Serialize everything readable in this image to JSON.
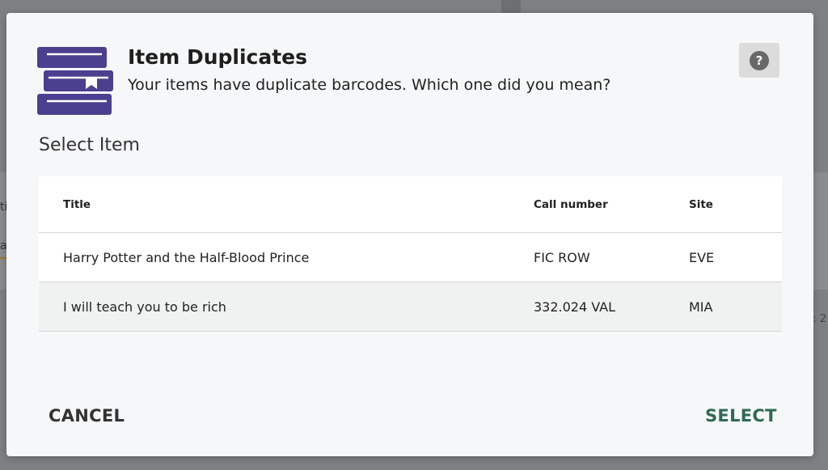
{
  "background": {
    "left_text_1": "ti",
    "left_text_2": "a",
    "right_text": ": 2"
  },
  "dialog": {
    "title": "Item Duplicates",
    "subtitle": "Your items have duplicate barcodes. Which one did you mean?",
    "help_icon": "question-mark-icon",
    "help_label": "?",
    "header_icon": "books-stack-icon",
    "section_label": "Select Item",
    "table": {
      "columns": [
        "Title",
        "Call number",
        "Site"
      ],
      "rows": [
        {
          "title": "Harry Potter and the Half-Blood Prince",
          "call_number": "FIC ROW",
          "site": "EVE"
        },
        {
          "title": "I will teach you to be rich",
          "call_number": "332.024 VAL",
          "site": "MIA"
        }
      ]
    },
    "cancel_label": "CANCEL",
    "select_label": "SELECT"
  },
  "colors": {
    "icon_purple": "#4b3f8f",
    "select_green": "#2e6b52"
  }
}
